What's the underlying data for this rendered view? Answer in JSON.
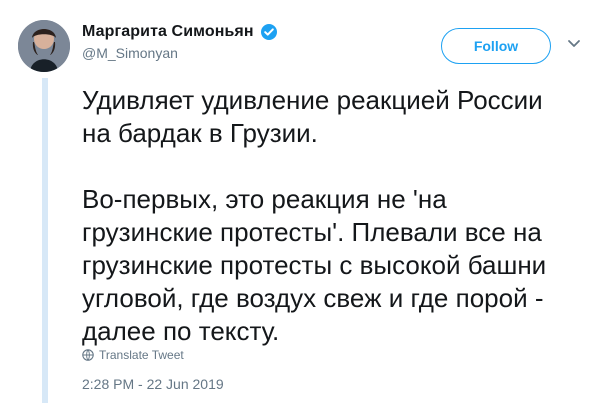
{
  "author": {
    "display_name": "Маргарита Симоньян",
    "handle": "@M_Simonyan",
    "verified": true
  },
  "actions": {
    "follow_label": "Follow",
    "more_icon": "chevron-down-icon"
  },
  "tweet": {
    "lines": [
      "Удивляет удивление реакцией России",
      "на бардак в Грузии.",
      "",
      "Во-первых, это реакция не 'на",
      "грузинские протесты'. Плевали все на",
      "грузинские протесты с высокой башни",
      "угловой, где воздух свеж и где порой -",
      "далее по тексту."
    ],
    "translate_label": "Translate Tweet",
    "timestamp": "2:28 PM - 22 Jun 2019"
  },
  "colors": {
    "accent": "#1da1f2",
    "text": "#14171a",
    "muted": "#657786",
    "rail": "#d7e8f7"
  }
}
